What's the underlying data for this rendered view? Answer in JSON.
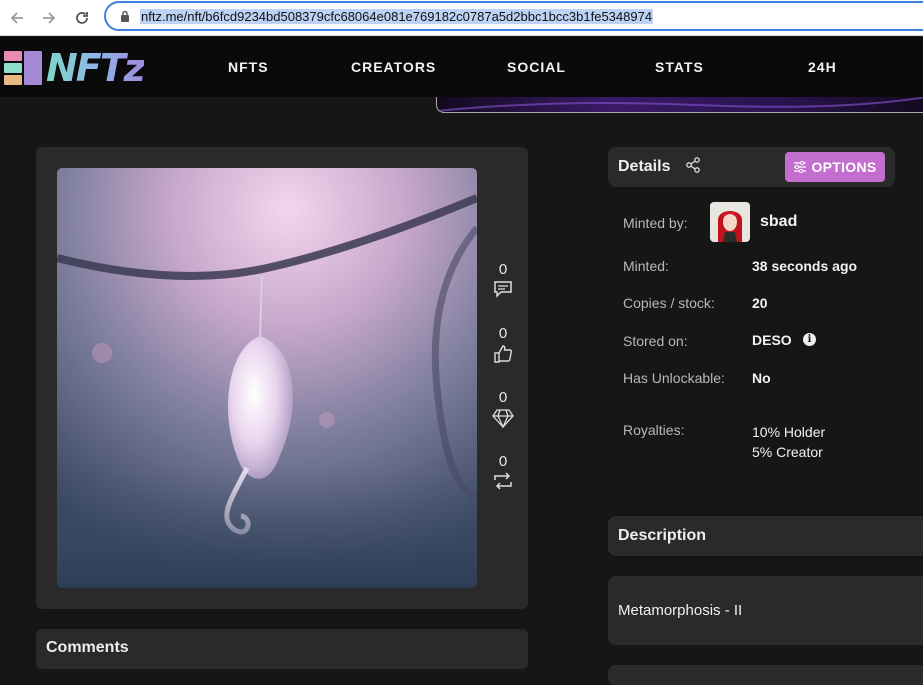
{
  "browser": {
    "url": "nftz.me/nft/b6fcd9234bd508379cfc68064e081e769182c0787a5d2bbc1bcc3b1fe5348974",
    "back_icon": "arrow-left-icon",
    "forward_icon": "arrow-right-icon",
    "reload_icon": "reload-icon"
  },
  "header": {
    "logo_text": "NFTz",
    "nav": [
      "NFTS",
      "CREATORS",
      "SOCIAL",
      "STATS",
      "24H"
    ]
  },
  "nft": {
    "stats": [
      {
        "icon": "comment-icon",
        "count": "0"
      },
      {
        "icon": "like-icon",
        "count": "0"
      },
      {
        "icon": "diamond-icon",
        "count": "0"
      },
      {
        "icon": "repost-icon",
        "count": "0"
      }
    ]
  },
  "comments": {
    "title": "Comments"
  },
  "details": {
    "title": "Details",
    "options_label": "OPTIONS",
    "minted_by_label": "Minted by:",
    "minter": "sbad",
    "rows": [
      {
        "label": "Minted:",
        "value": "38 seconds ago"
      },
      {
        "label": "Copies / stock:",
        "value": "20"
      },
      {
        "label": "Stored on:",
        "value": "DESO"
      },
      {
        "label": "Has Unlockable:",
        "value": "No"
      }
    ],
    "royalties_label": "Royalties:",
    "royalties": [
      "10% Holder",
      "5% Creator"
    ]
  },
  "description": {
    "title": "Description",
    "text": "Metamorphosis - II"
  },
  "colors": {
    "accent": "#c36dcf",
    "background": "#161616",
    "panel": "#2a2a2a",
    "header": "#0a0a0a"
  }
}
